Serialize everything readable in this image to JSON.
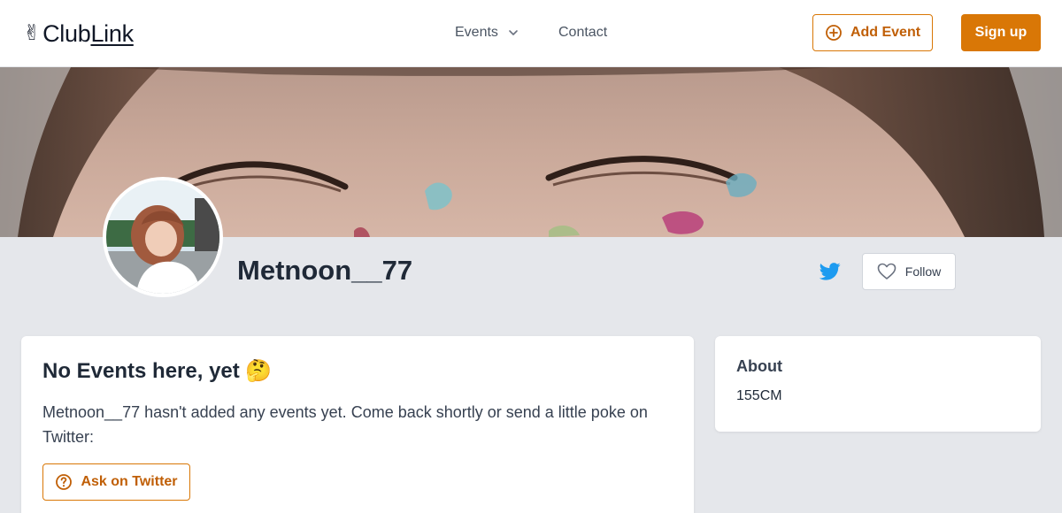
{
  "header": {
    "logo_text_plain": "Club",
    "logo_text_underlined": "Link",
    "nav": {
      "events_label": "Events",
      "contact_label": "Contact"
    },
    "add_event_label": "Add Event",
    "sign_up_label": "Sign up"
  },
  "profile": {
    "username": "Metnoon__77",
    "follow_label": "Follow"
  },
  "events": {
    "title": "No Events here, yet 🤔",
    "message": "Metnoon__77 hasn't added any events yet. Come back shortly or send a little poke on Twitter:",
    "ask_label": "Ask on Twitter"
  },
  "about": {
    "title": "About",
    "text": "155CM"
  },
  "colors": {
    "accent": "#d97706",
    "twitter": "#1d9bf0",
    "background": "#e5e7eb"
  },
  "icons": {
    "logo": "victory-hand-icon",
    "events_dropdown": "chevron-down-icon",
    "add_event": "plus-circle-icon",
    "twitter": "twitter-bird-icon",
    "follow": "heart-icon",
    "ask": "question-circle-icon"
  }
}
